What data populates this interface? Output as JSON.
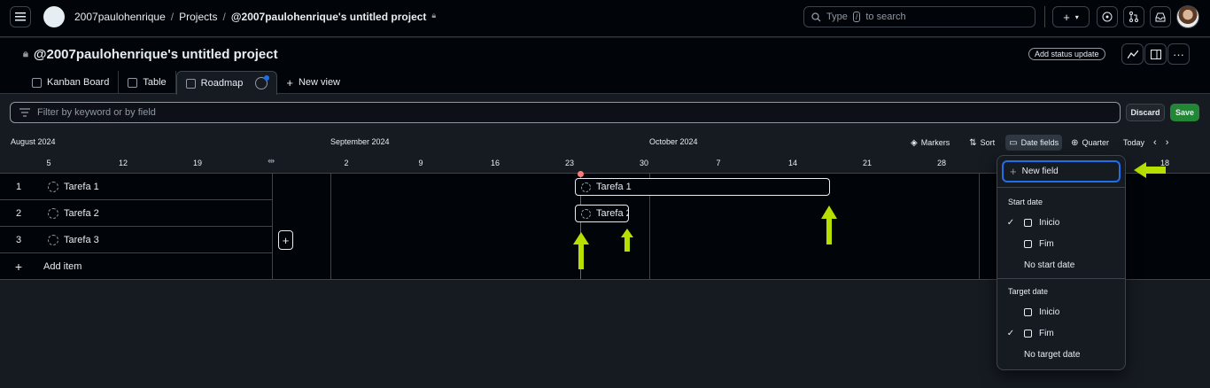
{
  "topbar": {
    "user": "2007paulohenrique",
    "projects": "Projects",
    "project": "@2007paulohenrique's untitled project",
    "search_prefix": "Type",
    "search_key": "/",
    "search_suffix": "to search"
  },
  "header": {
    "title": "@2007paulohenrique's untitled project",
    "status_button": "Add status update",
    "tabs": [
      {
        "label": "Kanban Board"
      },
      {
        "label": "Table"
      },
      {
        "label": "Roadmap"
      },
      {
        "label": "New view"
      }
    ]
  },
  "filter": {
    "placeholder": "Filter by keyword or by field",
    "discard": "Discard",
    "save": "Save"
  },
  "timeline": {
    "months": [
      "August 2024",
      "September 2024",
      "October 2024"
    ],
    "days": [
      "5",
      "12",
      "19",
      "2",
      "9",
      "16",
      "23",
      "30",
      "7",
      "14",
      "21",
      "28",
      "18"
    ],
    "controls": {
      "markers": "Markers",
      "sort": "Sort",
      "date_fields": "Date fields",
      "zoom": "Quarter",
      "today": "Today"
    }
  },
  "items": [
    {
      "num": "1",
      "title": "Tarefa 1"
    },
    {
      "num": "2",
      "title": "Tarefa 2"
    },
    {
      "num": "3",
      "title": "Tarefa 3"
    }
  ],
  "add_item": "Add item",
  "bars": [
    {
      "title": "Tarefa 1"
    },
    {
      "title": "Tarefa 2"
    }
  ],
  "date_menu": {
    "new_field": "New field",
    "start_heading": "Start date",
    "start_options": [
      "Inicio",
      "Fim"
    ],
    "no_start": "No start date",
    "target_heading": "Target date",
    "target_options": [
      "Inicio",
      "Fim"
    ],
    "no_target": "No target date",
    "check": "✓"
  },
  "colors": {
    "accent_green": "#b6e000",
    "today_line": "#da3633",
    "save_button": "#238636",
    "focus_blue": "#1f6feb"
  }
}
